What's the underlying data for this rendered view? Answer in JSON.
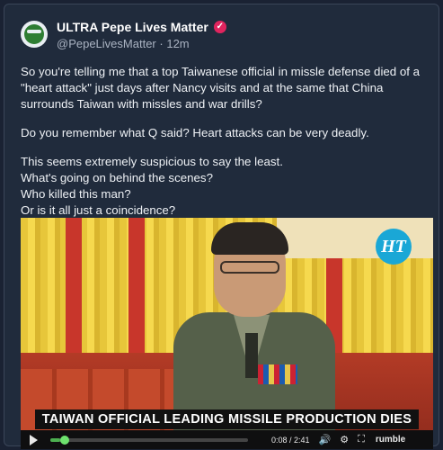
{
  "post": {
    "display_name": "ULTRA Pepe Lives Matter",
    "handle": "@PepeLivesMatter",
    "separator": "·",
    "time": "12m",
    "paragraph1": "So you're telling me that a top Taiwanese official in missle defense died of a \"heart attack\" just days after Nancy visits and at the same that China surrounds Taiwan with missles and war drills?",
    "paragraph2": "Do you remember what Q said? Heart attacks can be very deadly.",
    "lines": [
      "This seems extremely suspicious to say the least.",
      "What's going on behind the scenes?",
      "Who killed this man?",
      "Or is it all just a coincidence?"
    ]
  },
  "video": {
    "headline": "TAIWAN OFFICIAL LEADING MISSILE PRODUCTION DIES",
    "logo_text": "HT",
    "time_display": "0:08 / 2:41",
    "progress_fraction": 0.05,
    "brand": "rumble"
  },
  "icons": {
    "verified": "verified-badge-icon",
    "play": "play-icon",
    "volume": "volume-icon",
    "settings": "settings-icon",
    "fullscreen": "fullscreen-icon"
  },
  "colors": {
    "background": "#1a2233",
    "card": "#202b3c",
    "verified": "#e0245e",
    "progress": "#4caf50"
  }
}
